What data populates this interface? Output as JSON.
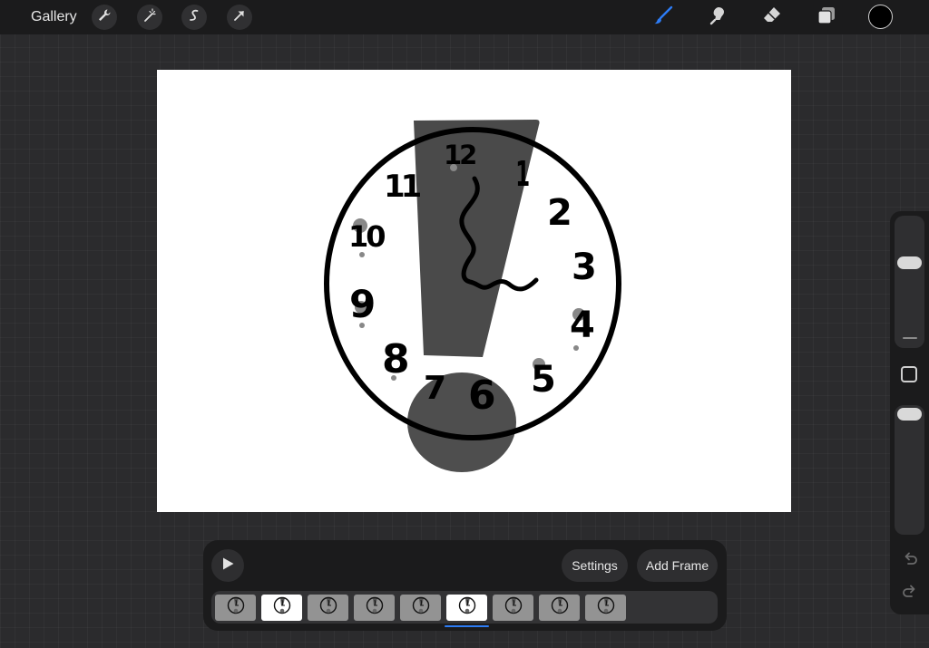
{
  "toolbar": {
    "gallery_label": "Gallery",
    "left_tools": [
      "wrench-icon",
      "magic-wand-icon",
      "selection-icon",
      "transform-arrow-icon"
    ],
    "right_tools": [
      "brush-icon",
      "smudge-icon",
      "eraser-icon",
      "layers-icon"
    ],
    "active_tool": "brush",
    "current_color": "#000000",
    "accent_color": "#2d7cf5"
  },
  "canvas": {
    "background": "#ffffff",
    "clock_numbers": [
      "12",
      "1",
      "2",
      "3",
      "4",
      "5",
      "6",
      "7",
      "8",
      "9",
      "10",
      "11"
    ]
  },
  "sidebar": {
    "brush_size_level": 0.85,
    "opacity_level": 1.0,
    "undo_icon": "undo-icon",
    "redo_icon": "redo-icon"
  },
  "animation": {
    "play_icon": "play-icon",
    "settings_label": "Settings",
    "add_frame_label": "Add Frame",
    "frame_count": 9,
    "light_frames": [
      2,
      6
    ],
    "selected_frame": 6
  }
}
